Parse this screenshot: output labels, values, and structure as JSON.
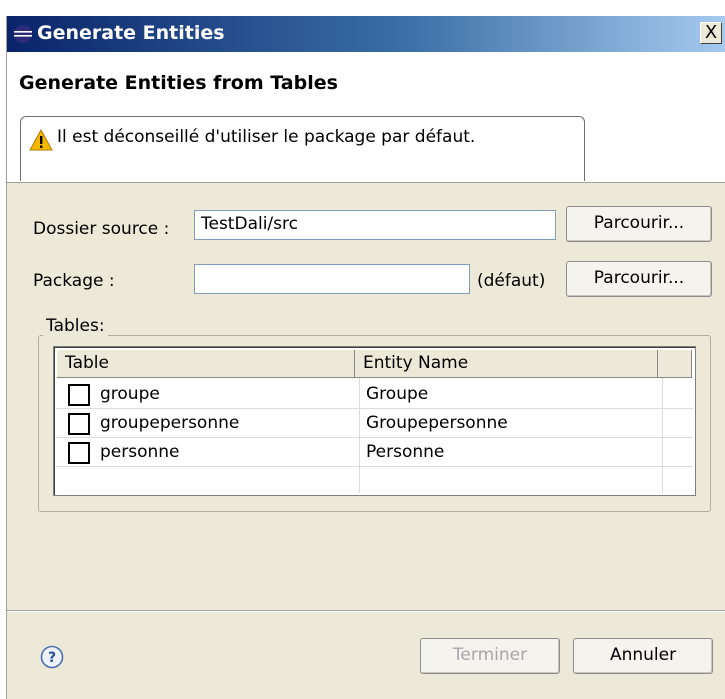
{
  "window": {
    "title": "Generate Entities",
    "close_glyph": "X"
  },
  "banner": {
    "title": "Generate Entities from Tables",
    "message": "Il est déconseillé d'utiliser le package par défaut.",
    "message_icon": "warning-icon"
  },
  "form": {
    "source_folder_label": "Dossier source :",
    "source_folder_value": "TestDali/src",
    "browse1_label": "Parcourir...",
    "package_label": "Package :",
    "package_value": "",
    "package_default_hint": "(défaut)",
    "browse2_label": "Parcourir..."
  },
  "tables": {
    "legend": "Tables:",
    "headers": [
      "Table",
      "Entity Name"
    ],
    "rows": [
      {
        "table": "groupe",
        "entity": "Groupe",
        "checked": false
      },
      {
        "table": "groupepersonne",
        "entity": "Groupepersonne",
        "checked": false
      },
      {
        "table": "personne",
        "entity": "Personne",
        "checked": false
      }
    ]
  },
  "footer": {
    "help_icon": "help-icon",
    "finish_label": "Terminer",
    "finish_enabled": false,
    "cancel_label": "Annuler"
  },
  "colors": {
    "title_bar_start": "#0a246a",
    "title_bar_end": "#a6caf0",
    "dialog_bg": "#ece9d8",
    "warning": "#f5b800"
  }
}
